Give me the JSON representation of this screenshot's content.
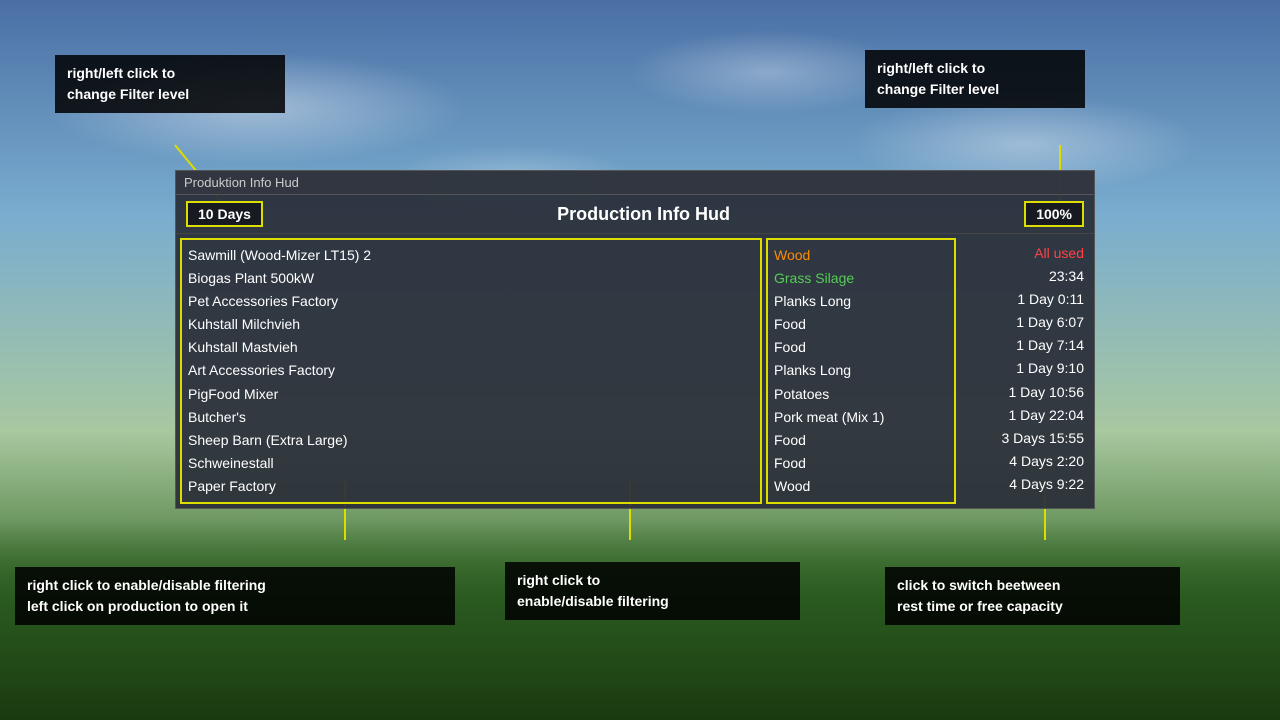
{
  "background": {
    "description": "Farming simulator sky and trees background"
  },
  "tooltips": {
    "top_left": {
      "line1": "right/left click to",
      "line2": "change Filter level"
    },
    "top_right": {
      "line1": "right/left click to",
      "line2": "change Filter level"
    },
    "bottom_left": {
      "line1": "right click to enable/disable filtering",
      "line2": "left click on production to open it"
    },
    "bottom_mid": {
      "line1": "right click to",
      "line2": "enable/disable filtering"
    },
    "bottom_right": {
      "line1": "click to switch beetween",
      "line2": "rest time or free capacity"
    }
  },
  "hud": {
    "title_bar": "Produktion Info Hud",
    "main_title": "Production Info Hud",
    "filter_days": "10 Days",
    "filter_percent": "100%",
    "productions": [
      {
        "name": "Sawmill (Wood-Mizer LT15) 2",
        "color": "white"
      },
      {
        "name": "Biogas Plant 500kW",
        "color": "white"
      },
      {
        "name": "Pet Accessories Factory",
        "color": "white"
      },
      {
        "name": "Kuhstall Milchvieh",
        "color": "white"
      },
      {
        "name": "Kuhstall Mastvieh",
        "color": "white"
      },
      {
        "name": "Art Accessories Factory",
        "color": "white"
      },
      {
        "name": "PigFood Mixer",
        "color": "white"
      },
      {
        "name": "Butcher's",
        "color": "white"
      },
      {
        "name": "Sheep Barn (Extra Large)",
        "color": "white"
      },
      {
        "name": "Schweinestall",
        "color": "white"
      },
      {
        "name": "Paper Factory",
        "color": "white"
      }
    ],
    "outputs": [
      {
        "name": "Wood",
        "color": "orange"
      },
      {
        "name": "Grass Silage",
        "color": "green-text"
      },
      {
        "name": "Planks Long",
        "color": "white"
      },
      {
        "name": "Food",
        "color": "white"
      },
      {
        "name": "Food",
        "color": "white"
      },
      {
        "name": "Planks Long",
        "color": "white"
      },
      {
        "name": "Potatoes",
        "color": "white"
      },
      {
        "name": "Pork meat (Mix 1)",
        "color": "white"
      },
      {
        "name": "Food",
        "color": "white"
      },
      {
        "name": "Food",
        "color": "white"
      },
      {
        "name": "Wood",
        "color": "white"
      }
    ],
    "times": [
      {
        "value": "All used",
        "color": "red-text"
      },
      {
        "value": "23:34",
        "color": "white"
      },
      {
        "value": "1 Day 0:11",
        "color": "white"
      },
      {
        "value": "1 Day 6:07",
        "color": "white"
      },
      {
        "value": "1 Day 7:14",
        "color": "white"
      },
      {
        "value": "1 Day 9:10",
        "color": "white"
      },
      {
        "value": "1 Day 10:56",
        "color": "white"
      },
      {
        "value": "1 Day 22:04",
        "color": "white"
      },
      {
        "value": "3 Days 15:55",
        "color": "white"
      },
      {
        "value": "4 Days 2:20",
        "color": "white"
      },
      {
        "value": "4 Days 9:22",
        "color": "white"
      }
    ]
  }
}
